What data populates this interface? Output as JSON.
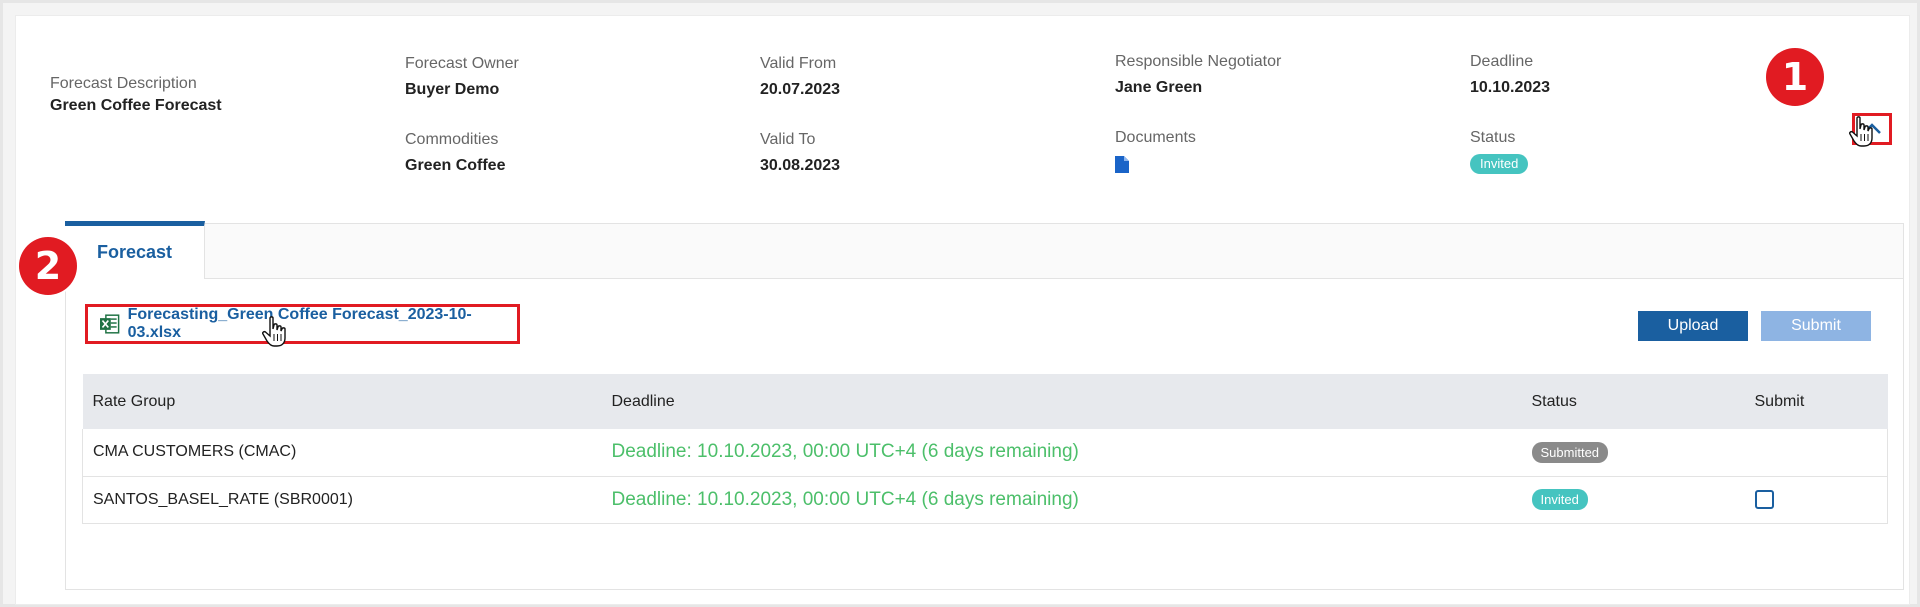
{
  "header": {
    "forecast_description": {
      "label": "Forecast Description",
      "value": "Green Coffee Forecast"
    },
    "forecast_owner": {
      "label": "Forecast Owner",
      "value": "Buyer Demo"
    },
    "commodities": {
      "label": "Commodities",
      "value": "Green Coffee"
    },
    "valid_from": {
      "label": "Valid From",
      "value": "20.07.2023"
    },
    "valid_to": {
      "label": "Valid To",
      "value": "30.08.2023"
    },
    "responsible_negotiator": {
      "label": "Responsible Negotiator",
      "value": "Jane Green"
    },
    "documents": {
      "label": "Documents",
      "icon": "document-icon"
    },
    "deadline": {
      "label": "Deadline",
      "value": "10.10.2023"
    },
    "status": {
      "label": "Status",
      "value": "Invited"
    }
  },
  "markers": [
    "1",
    "2"
  ],
  "tabs": [
    {
      "label": "Forecast",
      "active": true
    }
  ],
  "file": {
    "name": "Forecasting_Green Coffee Forecast_2023-10-03.xlsx",
    "icon": "excel-file-icon"
  },
  "actions": {
    "upload_label": "Upload",
    "submit_label": "Submit"
  },
  "table": {
    "columns": [
      "Rate Group",
      "Deadline",
      "Status",
      "Submit"
    ],
    "rows": [
      {
        "rate_group": "CMA CUSTOMERS (CMAC)",
        "deadline": "Deadline: 10.10.2023, 00:00 UTC+4 (6 days remaining)",
        "status": "Submitted",
        "submit_checkbox": false
      },
      {
        "rate_group": "SANTOS_BASEL_RATE (SBR0001)",
        "deadline": "Deadline: 10.10.2023, 00:00 UTC+4 (6 days remaining)",
        "status": "Invited",
        "submit_checkbox": true
      }
    ]
  },
  "colors": {
    "primary": "#1a5fa0",
    "highlight": "#e11b22",
    "deadline_green": "#4cbf6a",
    "invited_badge": "#45c4c0",
    "submitted_badge": "#8a8a8a"
  }
}
